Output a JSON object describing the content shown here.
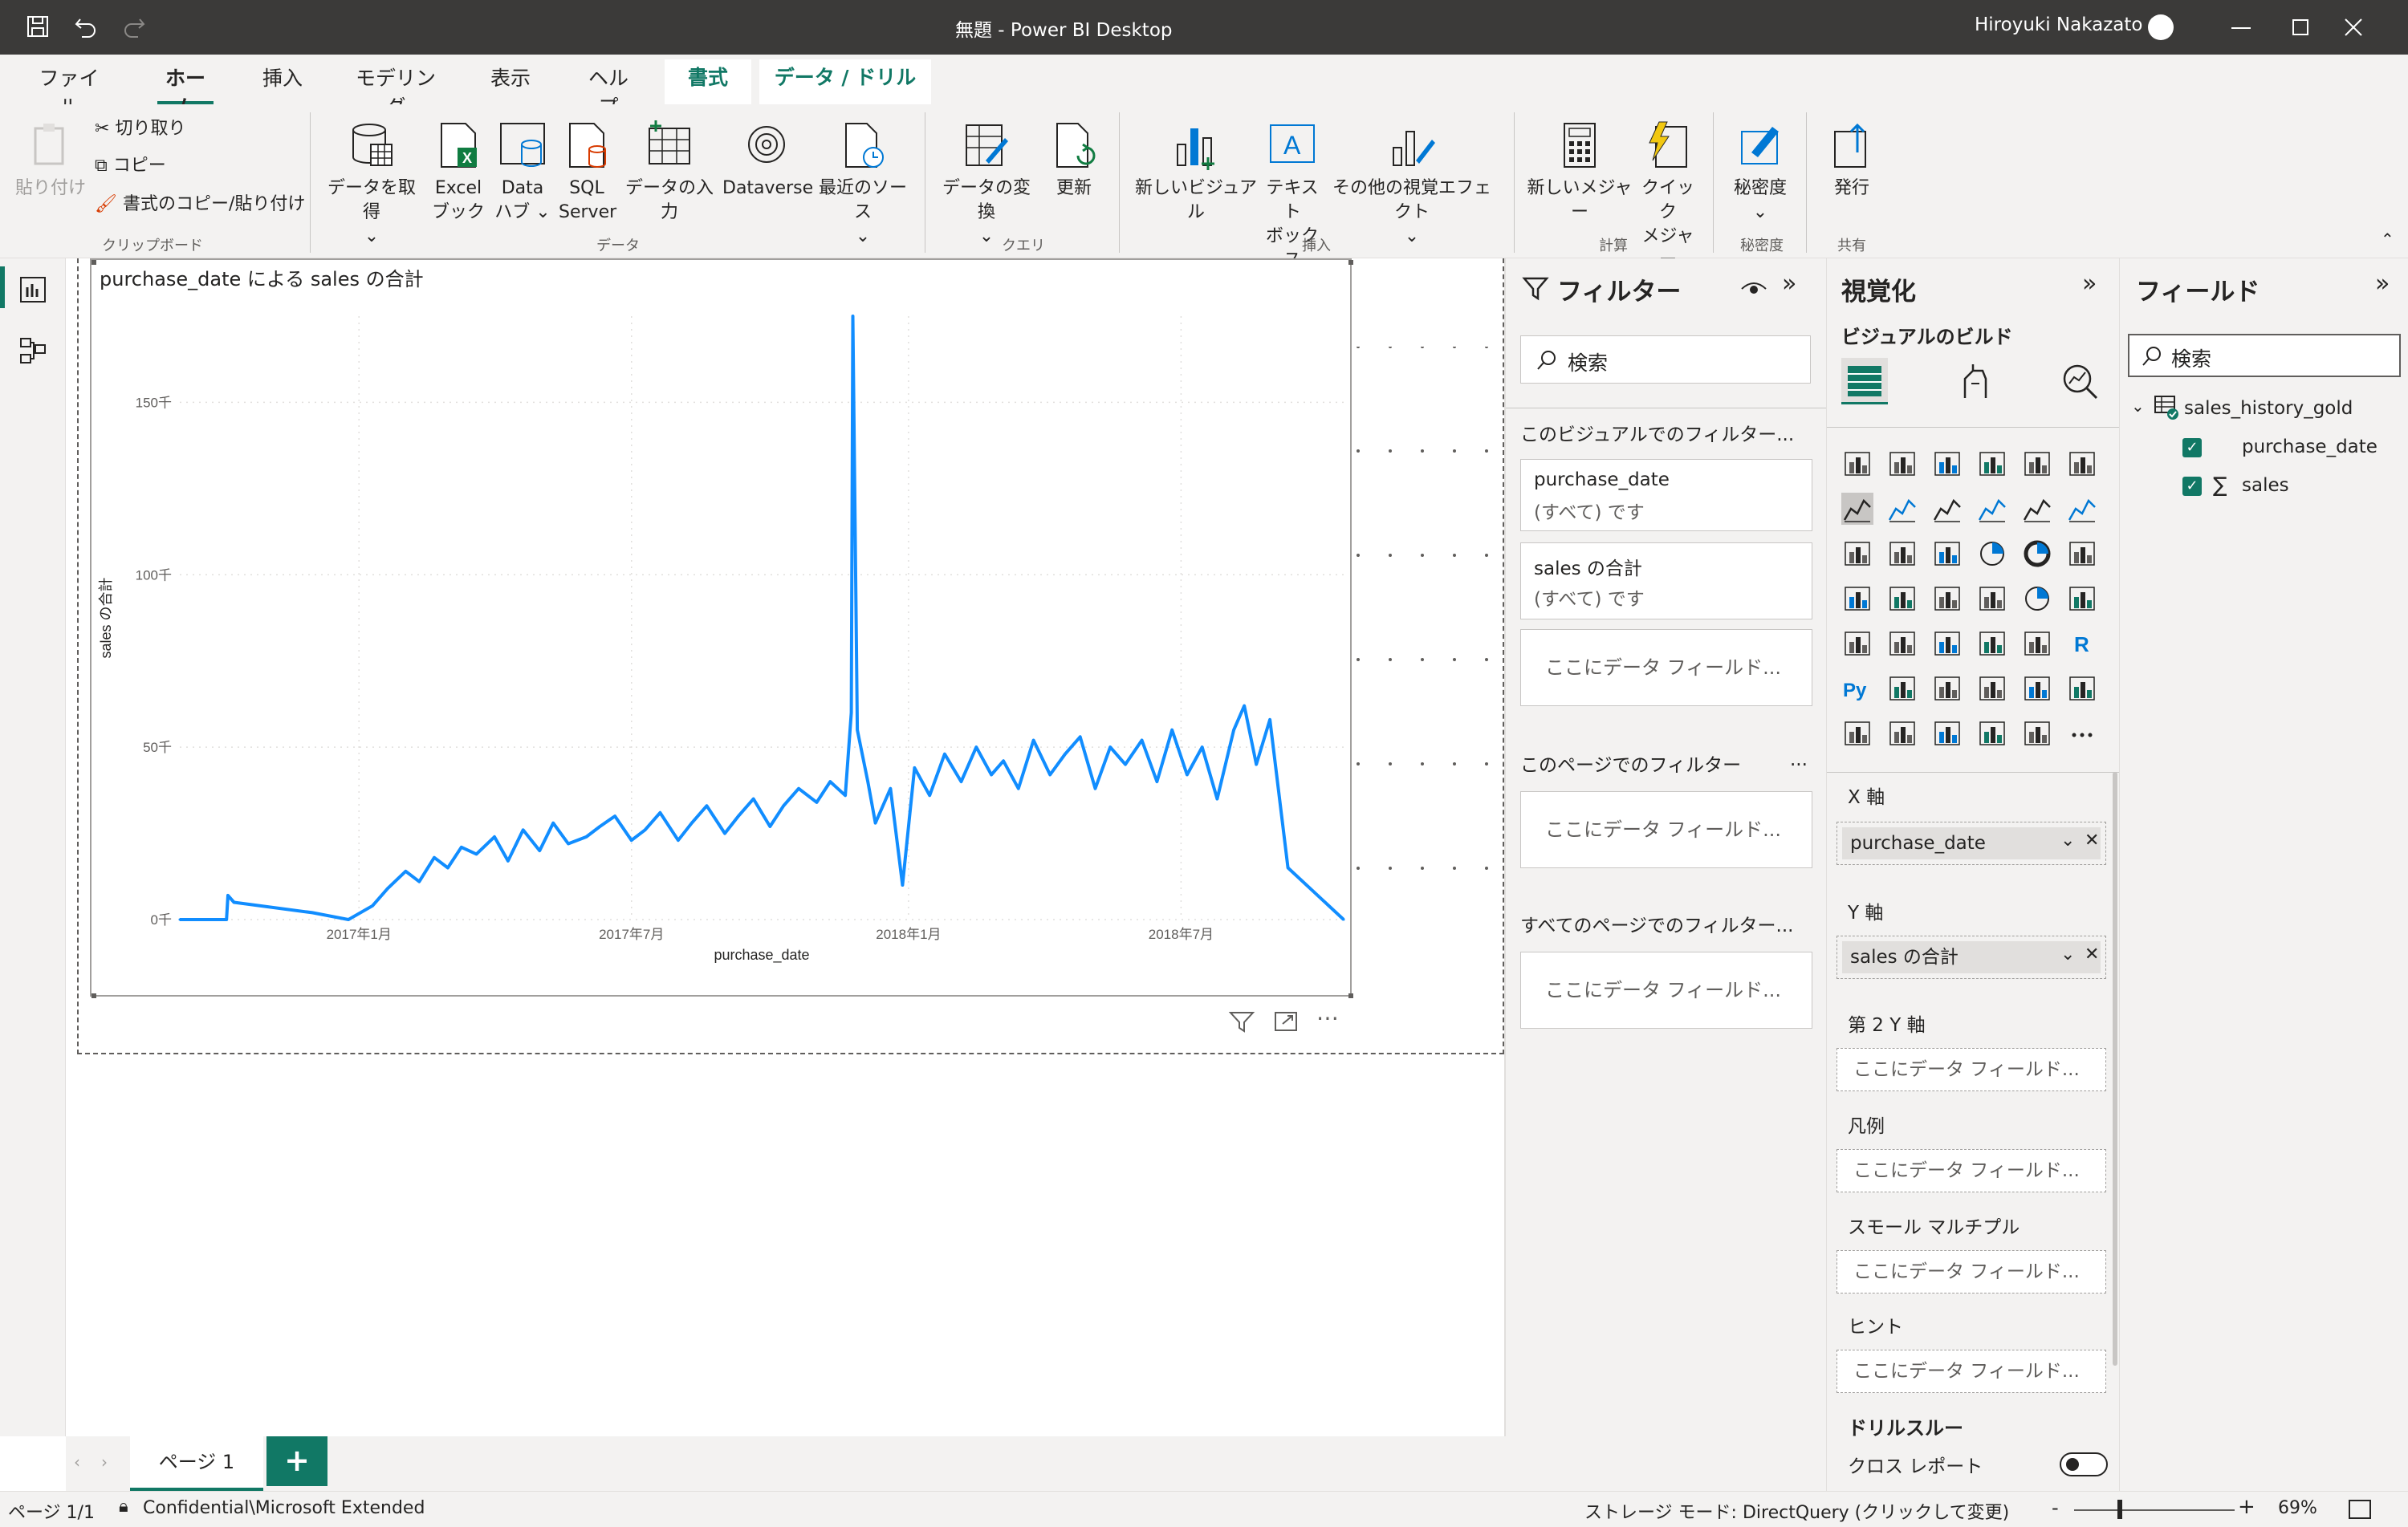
{
  "titlebar": {
    "title": "無題 - Power BI Desktop",
    "user": "Hiroyuki Nakazato"
  },
  "tabs": [
    {
      "label": "ファイル"
    },
    {
      "label": "ホーム"
    },
    {
      "label": "挿入"
    },
    {
      "label": "モデリング"
    },
    {
      "label": "表示"
    },
    {
      "label": "ヘルプ"
    },
    {
      "label": "書式"
    },
    {
      "label": "データ / ドリル"
    }
  ],
  "ribbon": {
    "paste": "貼り付け",
    "cut": "切り取り",
    "copy": "コピー",
    "format_painter": "書式のコピー/貼り付け",
    "group_clipboard": "クリップボード",
    "get_data": "データを取得",
    "excel_1": "Excel",
    "excel_2": "ブック",
    "datahub_1": "Data",
    "datahub_2": "ハブ",
    "sql_1": "SQL",
    "sql_2": "Server",
    "enter_data": "データの入力",
    "dataverse": "Dataverse",
    "recent": "最近のソース",
    "group_data": "データ",
    "transform": "データの変換",
    "refresh": "更新",
    "group_query": "クエリ",
    "new_visual": "新しいビジュアル",
    "textbox_1": "テキスト",
    "textbox_2": "ボックス",
    "more_visuals": "その他の視覚エフェクト",
    "group_insert": "挿入",
    "new_measure": "新しいメジャー",
    "quick_1": "クイック",
    "quick_2": "メジャー",
    "group_calc": "計算",
    "sensitivity": "秘密度",
    "group_sensitivity": "秘密度",
    "publish": "発行",
    "group_share": "共有"
  },
  "visual": {
    "title": "purchase_date による sales の合計"
  },
  "chart_data": {
    "type": "line",
    "title": "purchase_date による sales の合計",
    "xlabel": "purchase_date",
    "ylabel": "sales の合計",
    "xlim": [
      "2016-09-04",
      "2018-10-17"
    ],
    "ylim": [
      0,
      175000
    ],
    "yticks": [
      "0千",
      "50千",
      "100千",
      "150千"
    ],
    "xticks": [
      "2017年1月",
      "2017年7月",
      "2018年1月",
      "2018年7月"
    ],
    "grid": true,
    "color": "#118dff",
    "x": [
      "2016-09-04",
      "2016-10-05",
      "2016-10-06",
      "2016-10-10",
      "2016-12-01",
      "2016-12-25",
      "2017-01-10",
      "2017-01-20",
      "2017-02-01",
      "2017-02-10",
      "2017-02-20",
      "2017-03-01",
      "2017-03-10",
      "2017-03-20",
      "2017-04-01",
      "2017-04-10",
      "2017-04-20",
      "2017-05-01",
      "2017-05-10",
      "2017-05-20",
      "2017-06-01",
      "2017-06-10",
      "2017-06-20",
      "2017-07-01",
      "2017-07-10",
      "2017-07-20",
      "2017-08-01",
      "2017-08-10",
      "2017-08-20",
      "2017-09-01",
      "2017-09-10",
      "2017-09-20",
      "2017-10-01",
      "2017-10-10",
      "2017-10-20",
      "2017-11-01",
      "2017-11-10",
      "2017-11-20",
      "2017-11-24",
      "2017-11-25",
      "2017-11-28",
      "2017-12-05",
      "2017-12-10",
      "2017-12-20",
      "2017-12-28",
      "2018-01-05",
      "2018-01-15",
      "2018-01-25",
      "2018-02-05",
      "2018-02-15",
      "2018-02-25",
      "2018-03-05",
      "2018-03-15",
      "2018-03-25",
      "2018-04-05",
      "2018-04-15",
      "2018-04-25",
      "2018-05-05",
      "2018-05-15",
      "2018-05-25",
      "2018-06-05",
      "2018-06-15",
      "2018-06-25",
      "2018-07-05",
      "2018-07-15",
      "2018-07-25",
      "2018-08-05",
      "2018-08-12",
      "2018-08-20",
      "2018-08-29",
      "2018-09-10",
      "2018-10-17"
    ],
    "series": [
      {
        "values": [
          0,
          0,
          7000,
          5000,
          2000,
          0,
          4000,
          9000,
          14000,
          11000,
          18000,
          15000,
          21000,
          19000,
          24000,
          17000,
          26000,
          20000,
          28000,
          22000,
          24000,
          27000,
          30000,
          23000,
          26000,
          31000,
          23000,
          28000,
          33000,
          25000,
          30000,
          35000,
          27000,
          33000,
          38000,
          34000,
          40000,
          36000,
          60000,
          175000,
          55000,
          40000,
          28000,
          38000,
          10000,
          44000,
          36000,
          48000,
          40000,
          50000,
          42000,
          46000,
          38000,
          52000,
          42000,
          48000,
          53000,
          38000,
          50000,
          45000,
          52000,
          40000,
          55000,
          42000,
          50000,
          35000,
          55000,
          62000,
          45000,
          58000,
          15000,
          0
        ]
      }
    ]
  },
  "filters": {
    "title": "フィルター",
    "search_placeholder": "検索",
    "visual_section": "このビジュアルでのフィルター...",
    "card1_field": "purchase_date",
    "card1_state": "(すべて) です",
    "card2_field": "sales の合計",
    "card2_state": "(すべて) です",
    "add_here": "ここにデータ フィールド...",
    "page_section": "このページでのフィルター",
    "page_more": "...",
    "all_section": "すべてのページでのフィルター..."
  },
  "viz": {
    "title": "視覚化",
    "subtitle": "ビジュアルのビルド",
    "x_axis": "X 軸",
    "x_value": "purchase_date",
    "y_axis": "Y 軸",
    "y_value": "sales の合計",
    "y2_axis": "第 2 Y 軸",
    "legend": "凡例",
    "small_multiples": "スモール マルチプル",
    "tooltips": "ヒント",
    "add_here": "ここにデータ フィールド...",
    "drillthrough": "ドリルスルー",
    "cross_report": "クロス レポート"
  },
  "fields": {
    "title": "フィールド",
    "search_placeholder": "検索",
    "table": "sales_history_gold",
    "f1": "purchase_date",
    "f2": "sales"
  },
  "pages": {
    "page1": "ページ 1",
    "add": "+"
  },
  "status": {
    "page": "ページ 1/1",
    "sensitivity": "Confidential\\Microsoft Extended",
    "storage": "ストレージ モード: DirectQuery (クリックして変更)",
    "zoom": "69%"
  }
}
